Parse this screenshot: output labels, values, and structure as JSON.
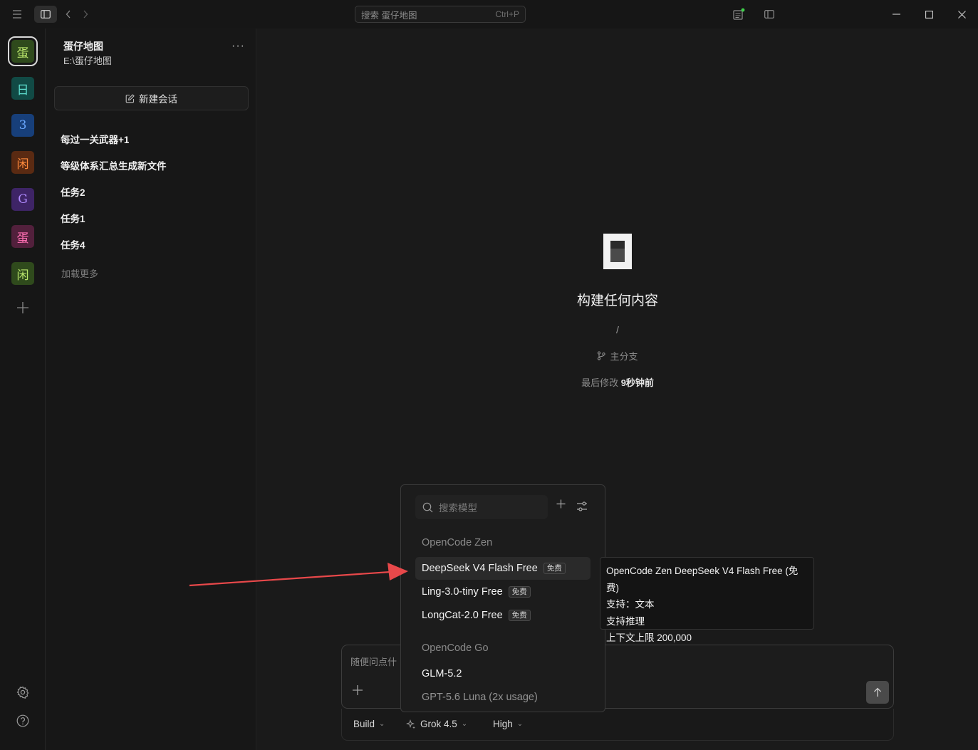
{
  "titlebar": {
    "search_placeholder": "搜索 蛋仔地图",
    "search_shortcut": "Ctrl+P",
    "status_dot_color": "#3ecf4a"
  },
  "rail": {
    "projects": [
      {
        "label": "蛋",
        "bg": "#2f4a1c",
        "fg": "#b7e36a",
        "active": true
      },
      {
        "label": "日",
        "bg": "#114a45",
        "fg": "#5fe0d1"
      },
      {
        "label": "3",
        "bg": "#173f7a",
        "fg": "#6aa8ff"
      },
      {
        "label": "闲",
        "bg": "#5a2a12",
        "fg": "#ff8a3c"
      },
      {
        "label": "G",
        "bg": "#3e2466",
        "fg": "#b08aff"
      },
      {
        "label": "蛋",
        "bg": "#52203c",
        "fg": "#ff6fb3"
      },
      {
        "label": "闲",
        "bg": "#2f4a1c",
        "fg": "#b7e36a"
      }
    ]
  },
  "sidebar": {
    "workspace_name": "蛋仔地图",
    "workspace_path": "E:\\蛋仔地图",
    "new_session_label": "新建会话",
    "sessions": [
      "每过一关武器+1",
      "等级体系汇总生成新文件",
      "任务2",
      "任务1",
      "任务4"
    ],
    "load_more": "加载更多"
  },
  "main": {
    "title": "构建任何内容",
    "path": "/",
    "branch": "主分支",
    "modified_label": "最后修改",
    "modified_value": "9秒钟前"
  },
  "composer": {
    "placeholder": "随便问点什",
    "agent": "Build",
    "model": "Grok 4.5",
    "effort": "High"
  },
  "model_picker": {
    "search_placeholder": "搜索模型",
    "groups": [
      {
        "name": "OpenCode Zen",
        "models": [
          {
            "name": "DeepSeek V4 Flash Free",
            "badge": "免费"
          },
          {
            "name": "Ling-3.0-tiny Free",
            "badge": "免费"
          },
          {
            "name": "LongCat-2.0 Free",
            "badge": "免费"
          }
        ]
      },
      {
        "name": "OpenCode Go",
        "models": [
          {
            "name": "GLM-5.2",
            "badge": ""
          },
          {
            "name": "GPT-5.6 Luna (2x usage)",
            "badge": ""
          }
        ]
      }
    ]
  },
  "tooltip": {
    "title": "OpenCode Zen DeepSeek V4 Flash Free (免费)",
    "supports": "支持：文本",
    "reasoning": "支持推理",
    "context": "上下文上限 200,000"
  },
  "annotation": {
    "arrow_color": "#e8484a"
  }
}
